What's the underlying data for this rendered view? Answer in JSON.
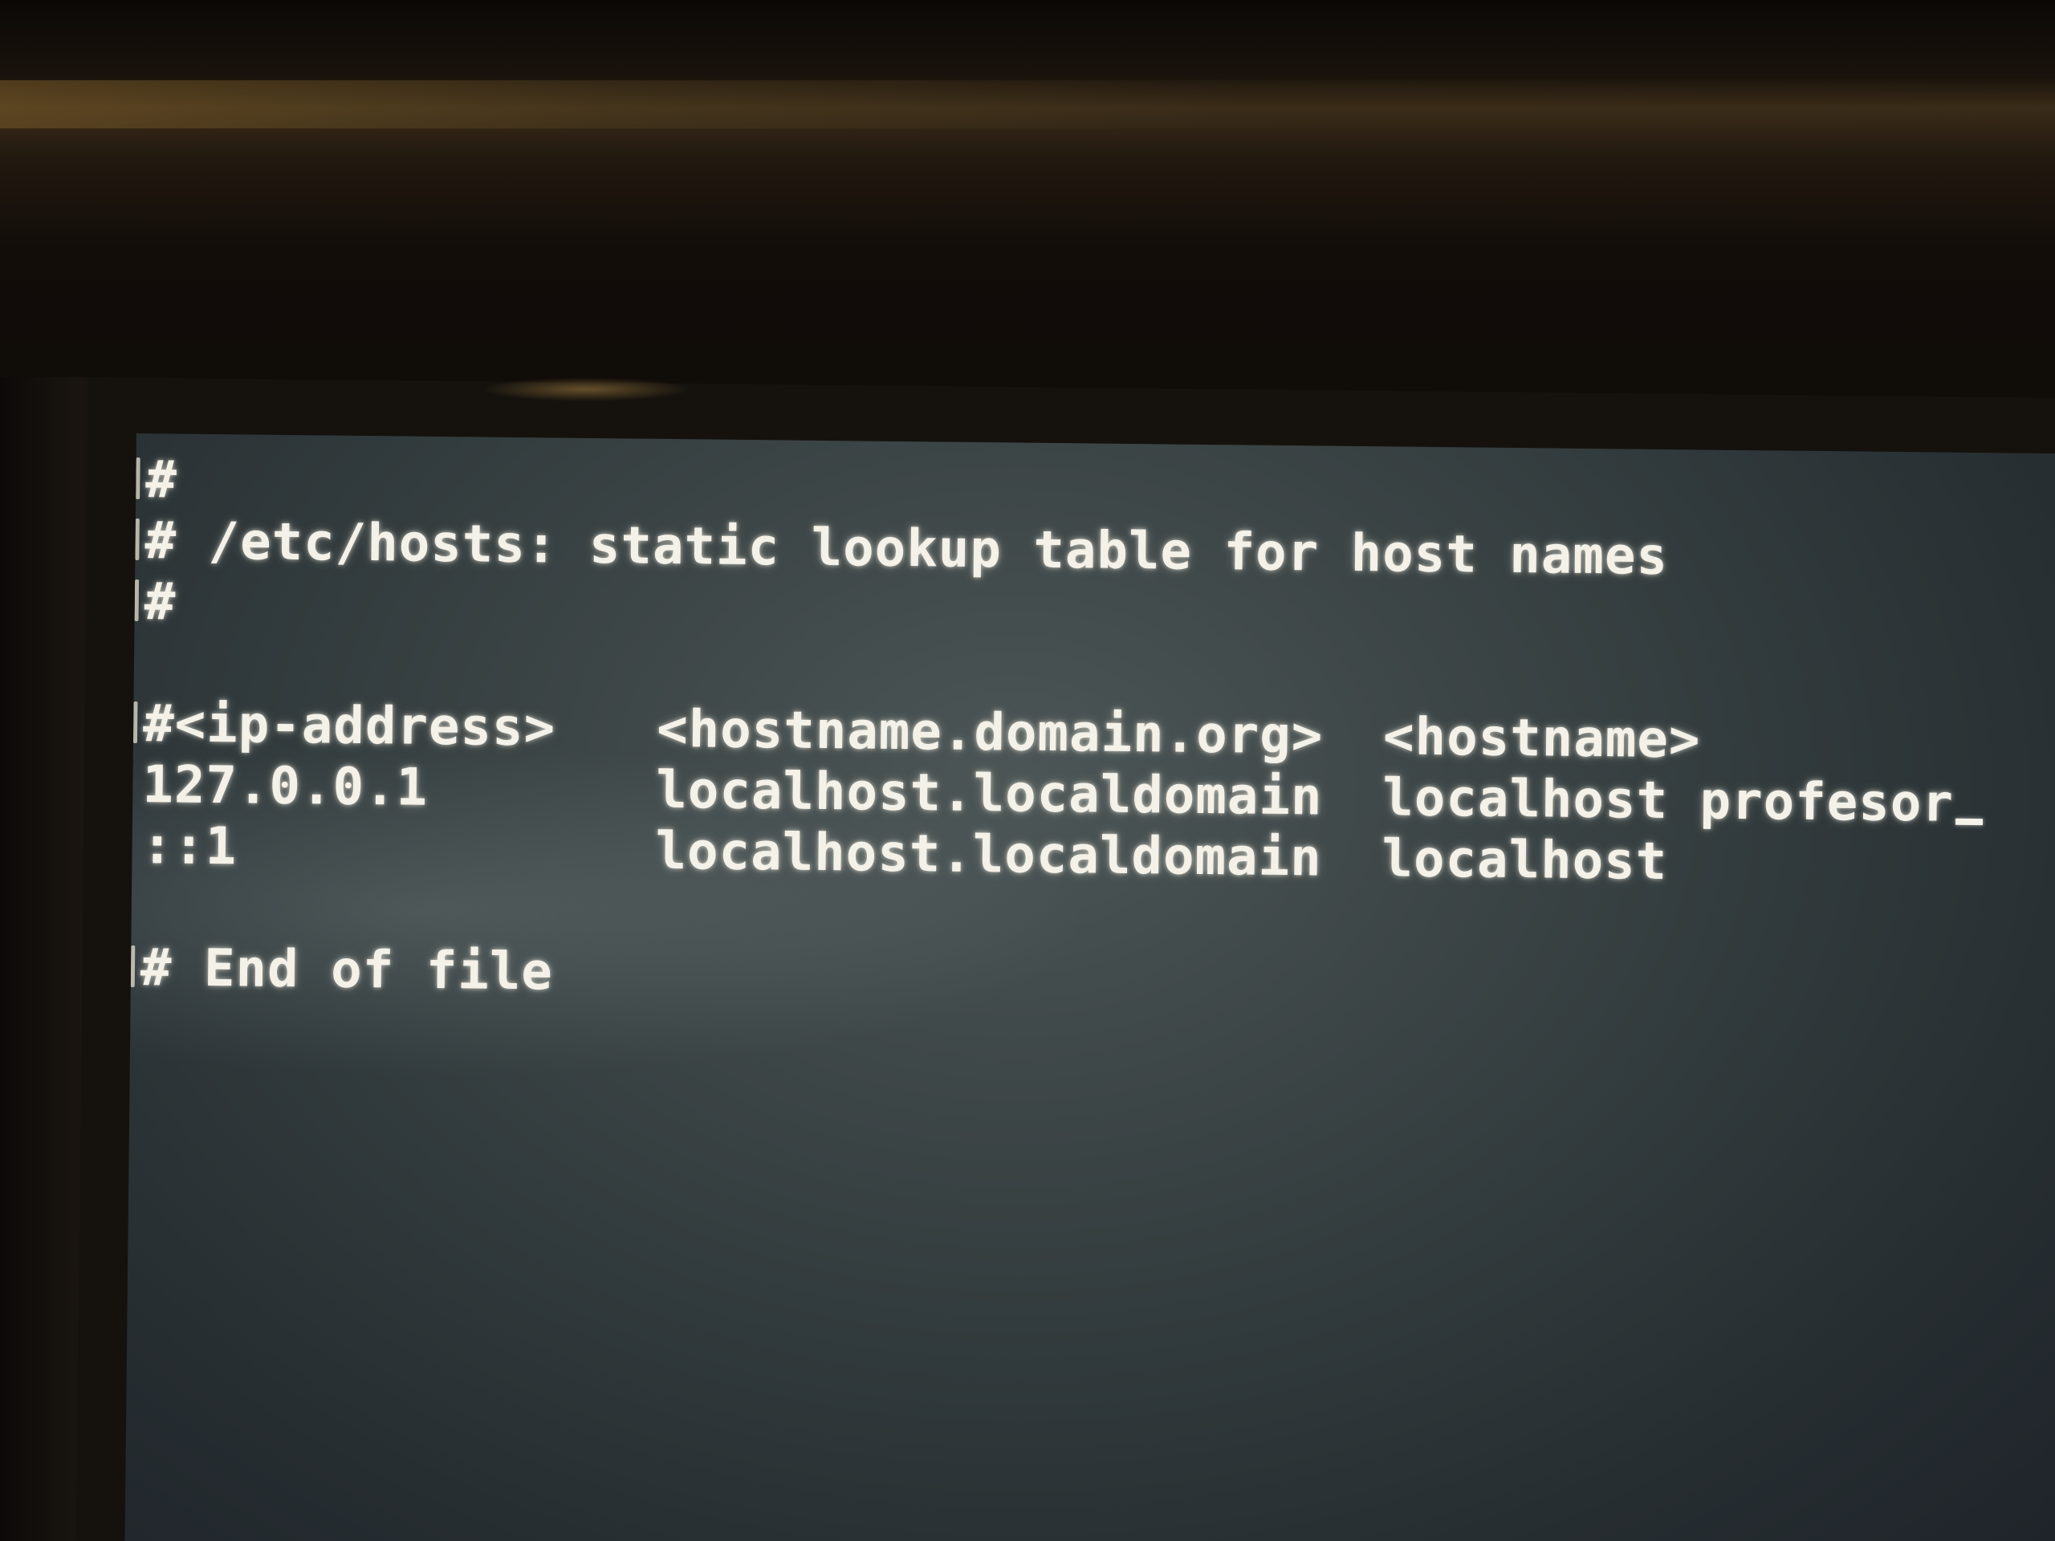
{
  "terminal": {
    "header_comment": [
      "#",
      "# /etc/hosts: static lookup table for host names",
      "#"
    ],
    "columns_header": {
      "ip": "#<ip-address>",
      "fqdn": "<hostname.domain.org>",
      "hostname": "<hostname>"
    },
    "entries": [
      {
        "ip": "127.0.0.1",
        "fqdn": "localhost.localdomain",
        "hostname": "localhost profesor"
      },
      {
        "ip": "::1",
        "fqdn": "localhost.localdomain",
        "hostname": "localhost"
      }
    ],
    "footer_comment": "# End of file"
  },
  "colors": {
    "terminal_text": "#f4f1e8",
    "screen_background": "#3f4849"
  }
}
